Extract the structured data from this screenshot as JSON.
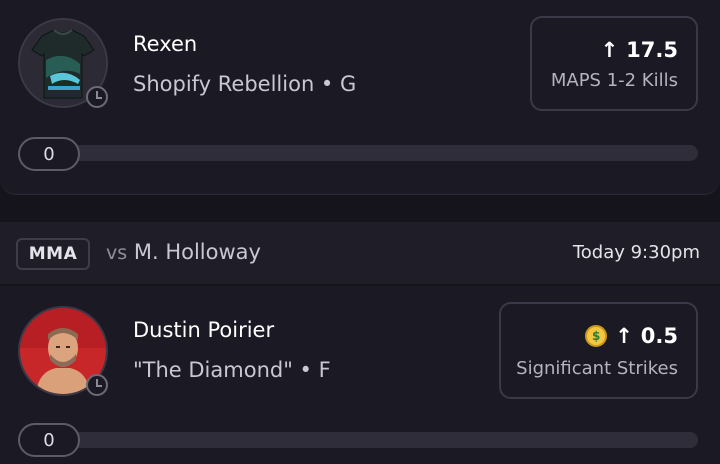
{
  "cards": [
    {
      "player_name": "Rexen",
      "team_position": "Shopify Rebellion • G",
      "direction_arrow": "↑",
      "line_value": "17.5",
      "stat_label": "MAPS 1-2 Kills",
      "progress_value": "0",
      "avatar_icon": "jersey-icon"
    },
    {
      "player_name": "Dustin Poirier",
      "team_position": "\"The Diamond\" • F",
      "direction_arrow": "↑",
      "line_value": "0.5",
      "stat_label": "Significant Strikes",
      "progress_value": "0",
      "avatar_icon": "fighter-headshot",
      "badge_icon": "money-face-icon"
    }
  ],
  "matchup": {
    "league": "MMA",
    "vs_prefix": "vs",
    "opponent": "M. Holloway",
    "time": "Today 9:30pm"
  },
  "colors": {
    "background": "#15141c",
    "card": "#1b1a24",
    "border": "#3a3947",
    "track": "#2e2d39"
  }
}
